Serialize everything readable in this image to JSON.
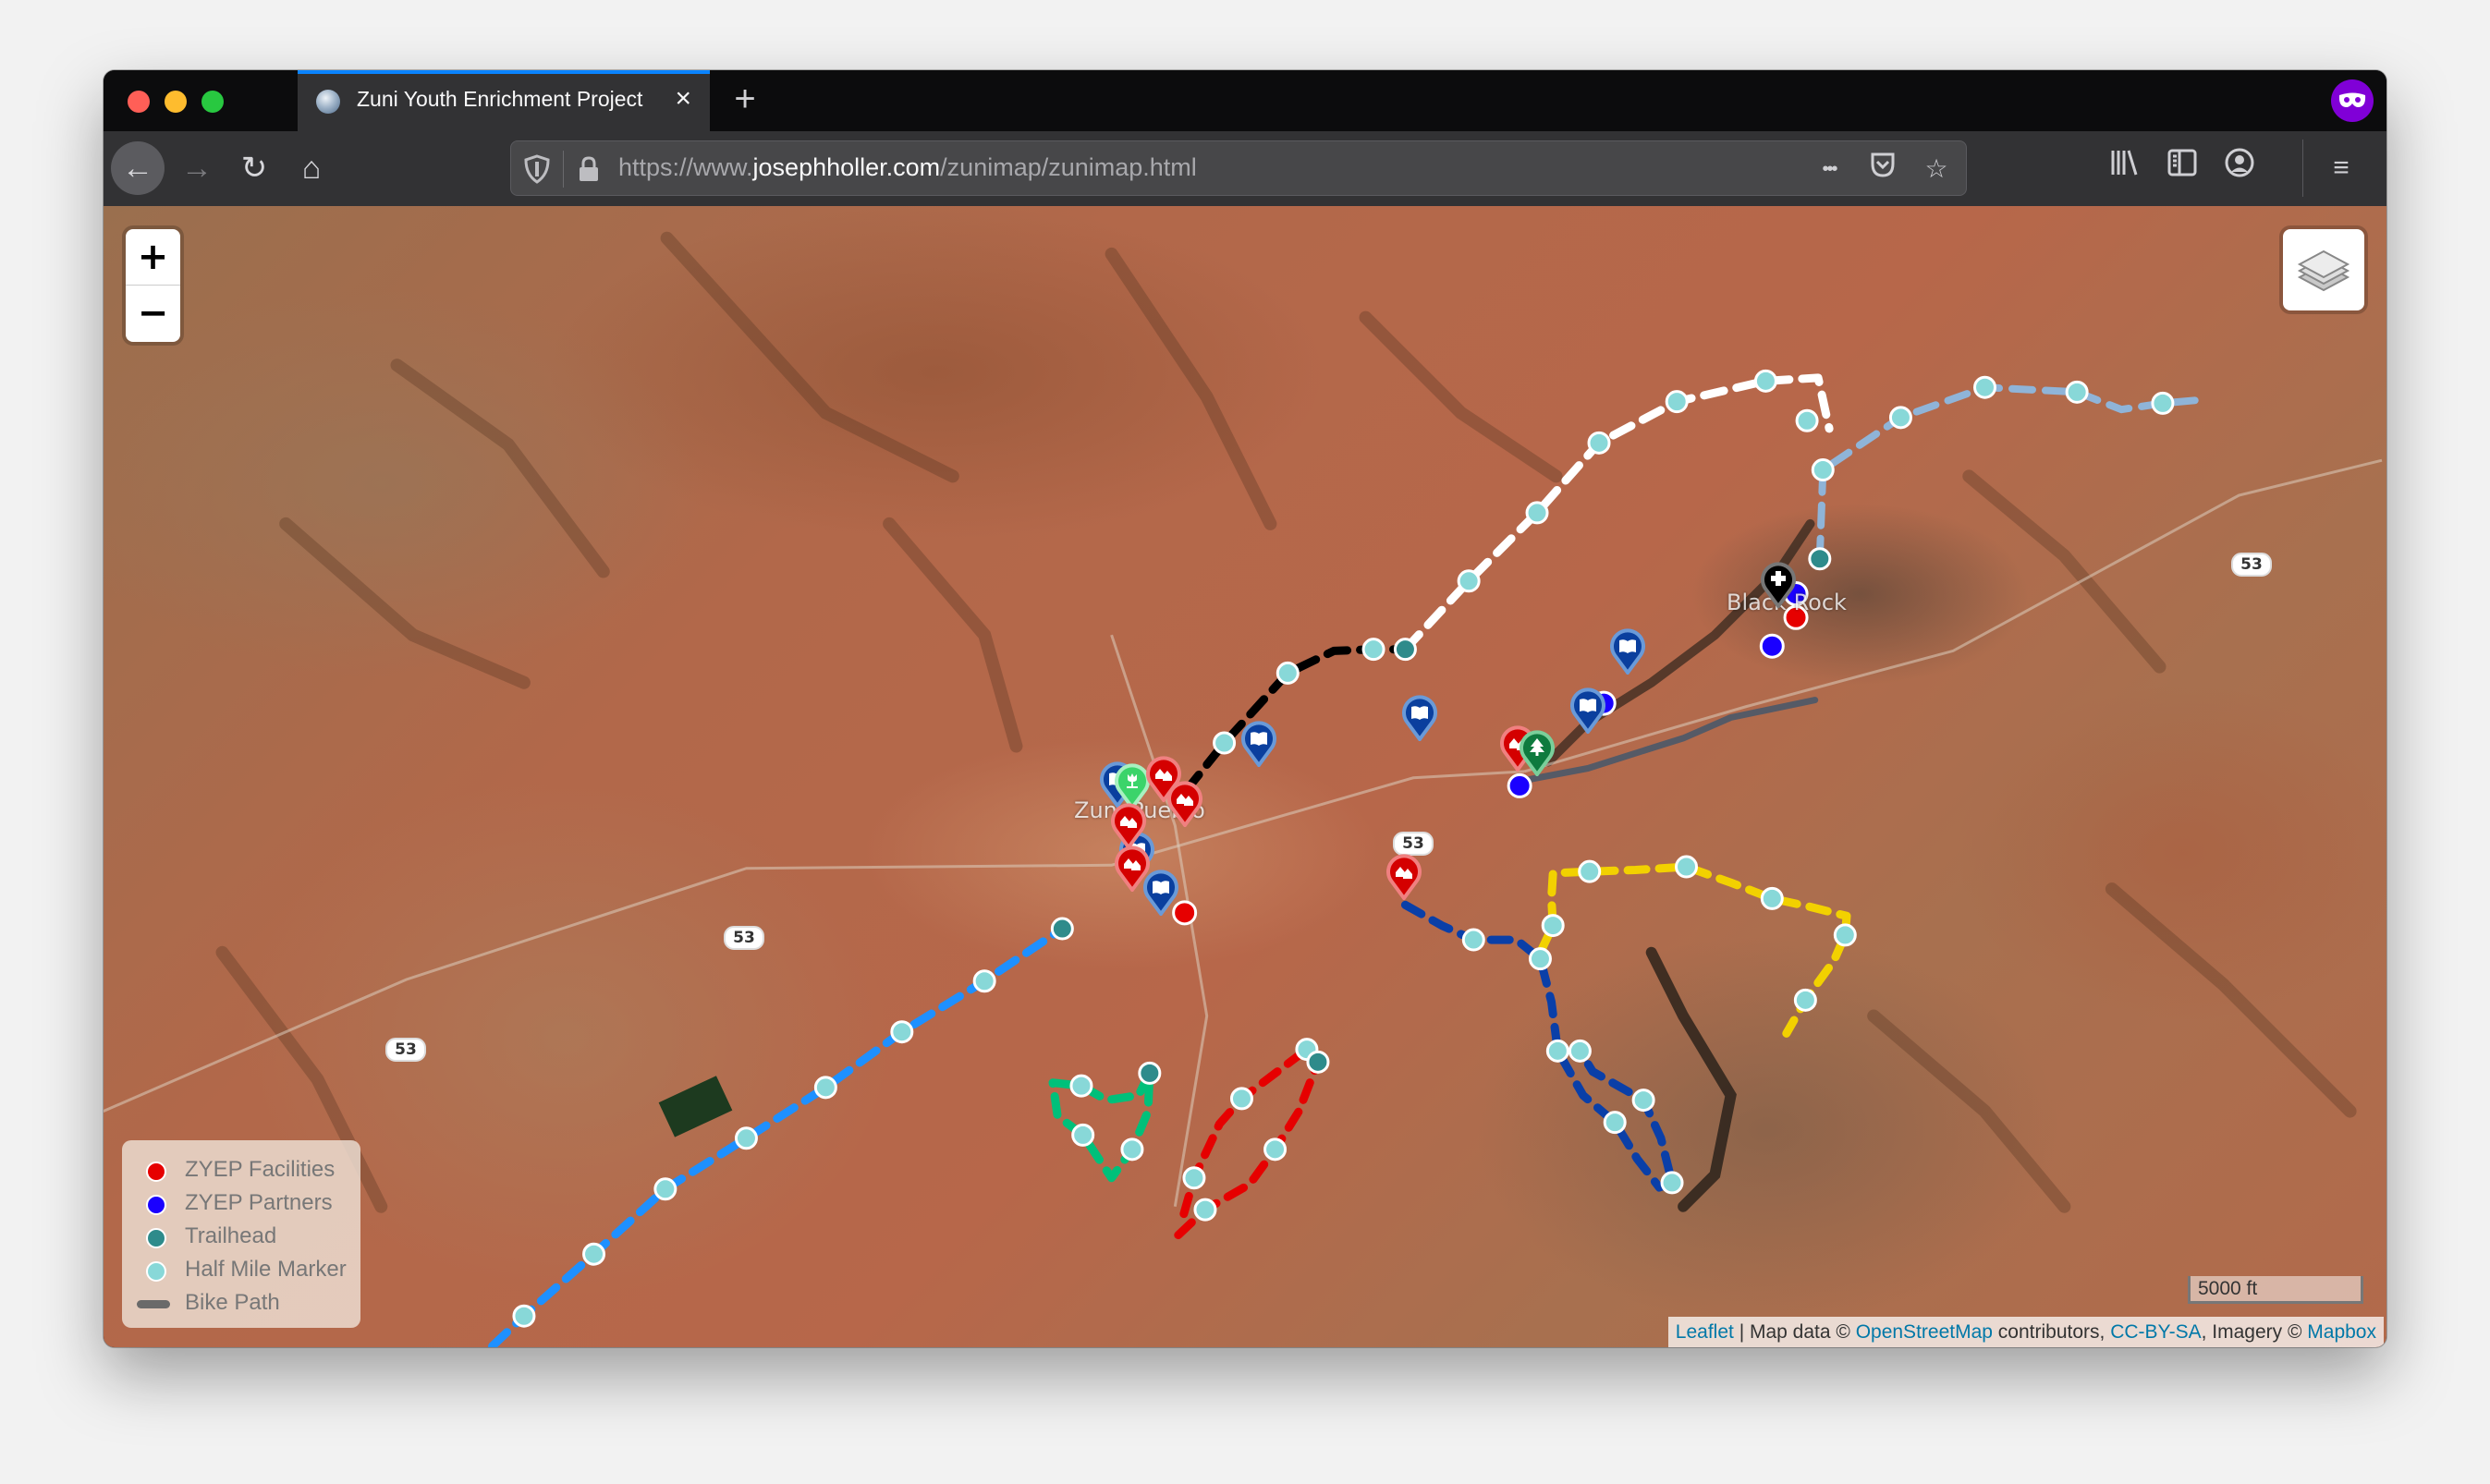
{
  "browser": {
    "tab": {
      "title": "Zuni Youth Enrichment Project",
      "favicon": "globe-icon",
      "close": "×"
    },
    "new_tab_label": "+",
    "url": {
      "scheme": "https://www.",
      "host": "josephholler.com",
      "path": "/zunimap/zunimap.html"
    },
    "toolbar_icons": [
      "back-icon",
      "forward-icon",
      "reload-icon",
      "home-icon",
      "shield-icon",
      "lock-icon",
      "more-icon",
      "pocket-icon",
      "bookmark-star-icon",
      "library-icon",
      "sidebar-icon",
      "account-icon",
      "menu-icon"
    ],
    "glyphs": {
      "back": "←",
      "forward": "→",
      "reload": "↻",
      "home": "⌂",
      "more": "•••",
      "star": "☆",
      "library": "|||\\",
      "menu": "≡"
    }
  },
  "map": {
    "zoom_in": "+",
    "zoom_out": "−",
    "layers_icon": "layers-icon",
    "scale": "5000 ft",
    "attribution": {
      "leaflet": "Leaflet",
      "sep": " | Map data © ",
      "osm": "OpenStreetMap",
      "contrib": " contributors, ",
      "license": "CC-BY-SA",
      "imagery": ", Imagery © ",
      "mapbox": "Mapbox"
    },
    "places": {
      "zuni": "Zuni Pueblo",
      "black_rock": "Black Rock"
    },
    "route_shields": [
      "53",
      "53",
      "53",
      "53"
    ],
    "legend": [
      {
        "label": "ZYEP Facilities",
        "color": "#e60000",
        "type": "dot"
      },
      {
        "label": "ZYEP Partners",
        "color": "#1a00ff",
        "type": "dot"
      },
      {
        "label": "Trailhead",
        "color": "#2e8b8b",
        "type": "dot"
      },
      {
        "label": "Half Mile Marker",
        "color": "#88d8d8",
        "type": "dot"
      },
      {
        "label": "Bike Path",
        "color": "#6a6a6a",
        "type": "line"
      }
    ],
    "trail_colors": {
      "white": "#ffffff",
      "light_blue": "#8fb4d8",
      "black": "#000000",
      "long_blue": "#1e90ff",
      "green": "#00c07a",
      "red": "#e60000",
      "dark_blue": "#0a3fa8",
      "yellow": "#f2d100",
      "bike_path": "#555a66"
    },
    "marker_types": {
      "facility": {
        "fill": "#d40000",
        "ring": "#f08080",
        "glyph": "houses-icon"
      },
      "library": {
        "fill": "#0a3f9e",
        "ring": "#6a9ad8",
        "glyph": "book-icon"
      },
      "park": {
        "fill": "#0e7a3e",
        "ring": "#7acf9a",
        "glyph": "tree-icon"
      },
      "garden": {
        "fill": "#3bd46a",
        "ring": "#a8f0c0",
        "glyph": "sprout-icon"
      },
      "health": {
        "fill": "#000000",
        "ring": "#777777",
        "glyph": "plus-icon"
      }
    }
  }
}
